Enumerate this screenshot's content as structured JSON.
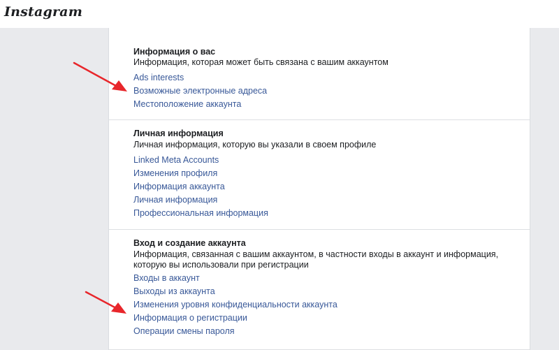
{
  "header": {
    "logo_text": "Instagram"
  },
  "sections": [
    {
      "title": "Информация о вас",
      "description": "Информация, которая может быть связана с вашим аккаунтом",
      "links": [
        "Ads interests",
        "Возможные электронные адреса",
        "Местоположение аккаунта"
      ]
    },
    {
      "title": "Личная информация",
      "description": "Личная информация, которую вы указали в своем профиле",
      "links": [
        "Linked Meta Accounts",
        "Изменения профиля",
        "Информация аккаунта",
        "Личная информация",
        "Профессиональная информация"
      ]
    },
    {
      "title": "Вход и создание аккаунта",
      "description": "Информация, связанная с вашим аккаунтом, в частности входы в аккаунт и информация, которую вы использовали при регистрации",
      "links": [
        "Входы в аккаунт",
        "Выходы из аккаунта",
        "Изменения уровня конфиденциальности аккаунта",
        "Информация о регистрации",
        "Операции смены пароля"
      ]
    }
  ],
  "colors": {
    "link": "#385898",
    "arrow": "#e8262b",
    "backdrop": "#e9eaed"
  }
}
